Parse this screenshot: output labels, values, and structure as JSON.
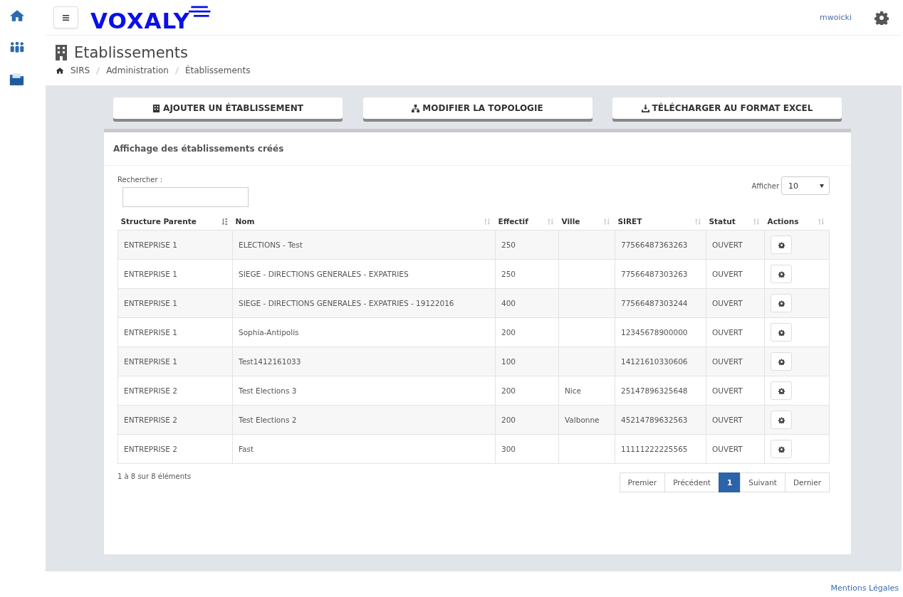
{
  "topbar": {
    "logo": "VOXALY",
    "user": "mwoicki"
  },
  "page": {
    "title": "Etablissements",
    "breadcrumb": [
      "SIRS",
      "Administration",
      "Établissements"
    ]
  },
  "actions": [
    {
      "kind": "building",
      "label": "AJOUTER UN ÉTABLISSEMENT"
    },
    {
      "kind": "sitemap",
      "label": "MODIFIER LA TOPOLOGIE"
    },
    {
      "kind": "download",
      "label": "TÉLÉCHARGER AU FORMAT EXCEL"
    }
  ],
  "panel": {
    "title": "Affichage des établissements créés",
    "search_label": "Rechercher :",
    "page_size_label": "Afficher",
    "page_size": "10"
  },
  "table": {
    "columns": [
      {
        "label": "Structure Parente",
        "sorted": true
      },
      {
        "label": "Nom",
        "sorted": false
      },
      {
        "label": "Effectif",
        "sorted": false
      },
      {
        "label": "Ville",
        "sorted": false
      },
      {
        "label": "SIRET",
        "sorted": false
      },
      {
        "label": "Statut",
        "sorted": false
      },
      {
        "label": "Actions",
        "sorted": false
      }
    ],
    "rows": [
      [
        "ENTREPRISE 1",
        "ELECTIONS - Test",
        "250",
        "",
        "77566487363263",
        "OUVERT"
      ],
      [
        "ENTREPRISE 1",
        "SIEGE - DIRECTIONS GENERALES - EXPATRIES",
        "250",
        "",
        "77566487303263",
        "OUVERT"
      ],
      [
        "ENTREPRISE 1",
        "SIEGE - DIRECTIONS GENERALES - EXPATRIES - 19122016",
        "400",
        "",
        "77566487303244",
        "OUVERT"
      ],
      [
        "ENTREPRISE 1",
        "Sophia-Antipolis",
        "200",
        "",
        "12345678900000",
        "OUVERT"
      ],
      [
        "ENTREPRISE 1",
        "Test1412161033",
        "100",
        "",
        "14121610330606",
        "OUVERT"
      ],
      [
        "ENTREPRISE 2",
        "Test Elections 3",
        "200",
        "Nice",
        "25147896325648",
        "OUVERT"
      ],
      [
        "ENTREPRISE 2",
        "Test Elections 2",
        "200",
        "Valbonne",
        "45214789632563",
        "OUVERT"
      ],
      [
        "ENTREPRISE 2",
        "Fast",
        "300",
        "",
        "11111222225565",
        "OUVERT"
      ]
    ]
  },
  "info": "1 à 8 sur 8 éléments",
  "pagination": [
    {
      "label": "Premier",
      "selected": false
    },
    {
      "label": "Précédent",
      "selected": false
    },
    {
      "label": "1",
      "selected": true
    },
    {
      "label": "Suivant",
      "selected": false
    },
    {
      "label": "Dernier",
      "selected": false
    }
  ],
  "footer": "Mentions Légales"
}
